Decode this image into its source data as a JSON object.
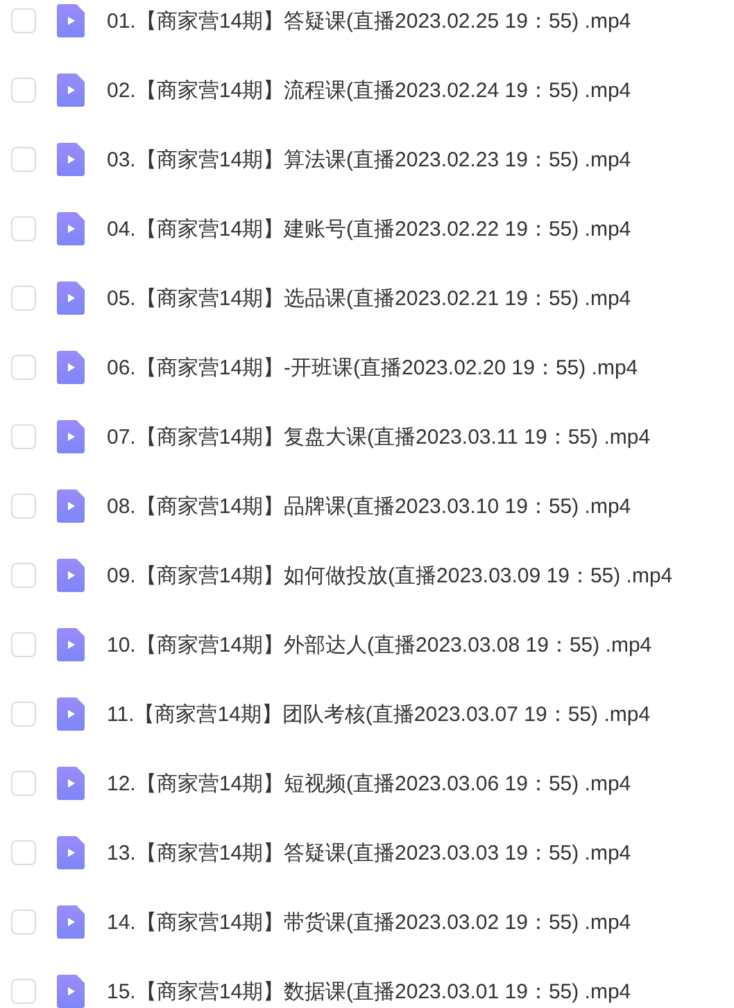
{
  "files": [
    {
      "name": "01.【商家营14期】答疑课(直播2023.02.25 19：55) .mp4",
      "checked": false
    },
    {
      "name": "02.【商家营14期】流程课(直播2023.02.24 19：55) .mp4",
      "checked": false
    },
    {
      "name": "03.【商家营14期】算法课(直播2023.02.23 19：55) .mp4",
      "checked": false
    },
    {
      "name": "04.【商家营14期】建账号(直播2023.02.22 19：55) .mp4",
      "checked": false
    },
    {
      "name": "05.【商家营14期】选品课(直播2023.02.21 19：55) .mp4",
      "checked": false
    },
    {
      "name": "06.【商家营14期】-开班课(直播2023.02.20 19：55) .mp4",
      "checked": false
    },
    {
      "name": "07.【商家营14期】复盘大课(直播2023.03.11 19：55) .mp4",
      "checked": false
    },
    {
      "name": "08.【商家营14期】品牌课(直播2023.03.10 19：55) .mp4",
      "checked": false
    },
    {
      "name": "09.【商家营14期】如何做投放(直播2023.03.09 19：55) .mp4",
      "checked": false
    },
    {
      "name": "10.【商家营14期】外部达人(直播2023.03.08 19：55) .mp4",
      "checked": false
    },
    {
      "name": "11.【商家营14期】团队考核(直播2023.03.07 19：55) .mp4",
      "checked": false
    },
    {
      "name": "12.【商家营14期】短视频(直播2023.03.06 19：55) .mp4",
      "checked": false
    },
    {
      "name": "13.【商家营14期】答疑课(直播2023.03.03 19：55) .mp4",
      "checked": false
    },
    {
      "name": "14.【商家营14期】带货课(直播2023.03.02 19：55) .mp4",
      "checked": false
    },
    {
      "name": "15.【商家营14期】数据课(直播2023.03.01 19：55) .mp4",
      "checked": false
    }
  ]
}
